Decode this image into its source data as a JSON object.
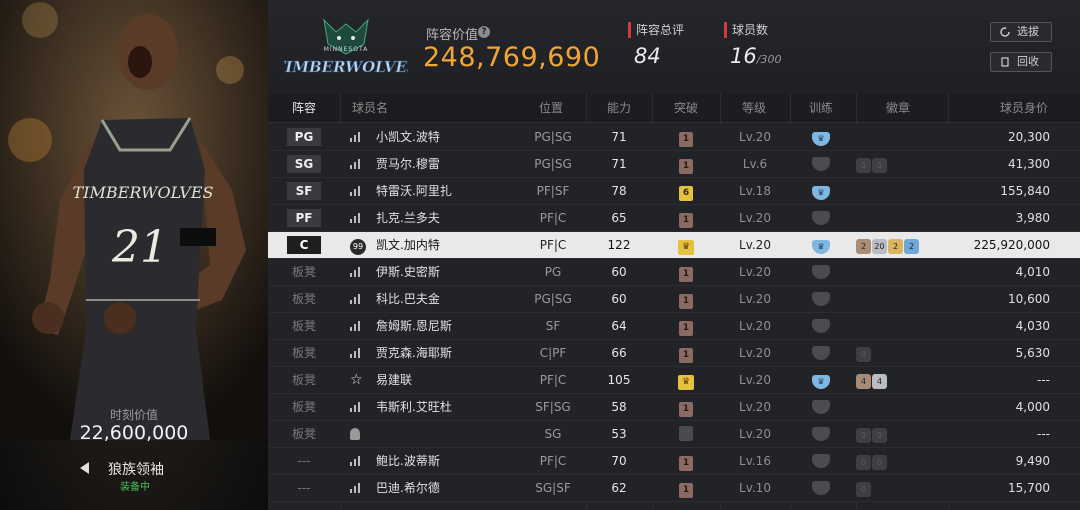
{
  "player_card": {
    "value_label": "时刻价值",
    "value": "22,600,000",
    "equip_name": "狼族领袖",
    "equip_status": "装备中",
    "jersey_team": "TIMBERWOLVES",
    "jersey_number": "21"
  },
  "header": {
    "logo_top": "MINNESOTA",
    "logo_main": "TIMBERWOLVES",
    "lineup_value_label": "阵容价值",
    "help_icon": "?",
    "lineup_value": "248,769,690",
    "rating_label": "阵容总评",
    "rating_value": "84",
    "count_label": "球员数",
    "count_value": "16",
    "count_total": "/300",
    "select_button": "选拔",
    "back_button": "回收"
  },
  "columns": {
    "slot": "阵容",
    "name": "球员名",
    "position": "位置",
    "ovr": "能力",
    "breakthrough": "突破",
    "level": "等级",
    "training": "训练",
    "badges": "徽章",
    "salary": "球员身价"
  },
  "rows": [
    {
      "slot": "PG",
      "bench": false,
      "icon": "bars",
      "name": "小凯文.波特",
      "position": "PG|SG",
      "ovr": "71",
      "brk": "1",
      "brk_style": "",
      "level": "Lv.20",
      "train": true,
      "badges": [],
      "salary": "20,300"
    },
    {
      "slot": "SG",
      "bench": false,
      "icon": "bars",
      "name": "贾马尔.穆雷",
      "position": "PG|SG",
      "ovr": "71",
      "brk": "1",
      "brk_style": "",
      "level": "Lv.6",
      "train": false,
      "badges": [
        {
          "t": "0",
          "c": "dim"
        },
        {
          "t": "0",
          "c": "dim"
        }
      ],
      "salary": "41,300"
    },
    {
      "slot": "SF",
      "bench": false,
      "icon": "bars",
      "name": "特雷沃.阿里扎",
      "position": "PF|SF",
      "ovr": "78",
      "brk": "6",
      "brk_style": "gold",
      "level": "Lv.18",
      "train": true,
      "badges": [],
      "salary": "155,840"
    },
    {
      "slot": "PF",
      "bench": false,
      "icon": "bars",
      "name": "扎克.兰多夫",
      "position": "PF|C",
      "ovr": "65",
      "brk": "1",
      "brk_style": "",
      "level": "Lv.20",
      "train": false,
      "badges": [],
      "salary": "3,980"
    },
    {
      "slot": "C",
      "bench": false,
      "selected": true,
      "icon": "99",
      "name": "凯文.加内特",
      "position": "PF|C",
      "ovr": "122",
      "brk": "♛",
      "brk_style": "crown",
      "level": "Lv.20",
      "train": true,
      "badges": [
        {
          "t": "2",
          "c": "bronze"
        },
        {
          "t": "20",
          "c": "silver"
        },
        {
          "t": "2",
          "c": "gold"
        },
        {
          "t": "2",
          "c": "blue"
        }
      ],
      "salary": "225,920,000"
    },
    {
      "slot": "板凳",
      "bench": true,
      "icon": "bars",
      "name": "伊斯.史密斯",
      "position": "PG",
      "ovr": "60",
      "brk": "1",
      "brk_style": "",
      "level": "Lv.20",
      "train": false,
      "badges": [],
      "salary": "4,010"
    },
    {
      "slot": "板凳",
      "bench": true,
      "icon": "bars",
      "name": "科比.巴夫金",
      "position": "PG|SG",
      "ovr": "60",
      "brk": "1",
      "brk_style": "",
      "level": "Lv.20",
      "train": false,
      "badges": [],
      "salary": "10,600"
    },
    {
      "slot": "板凳",
      "bench": true,
      "icon": "bars",
      "name": "詹姆斯.恩尼斯",
      "position": "SF",
      "ovr": "64",
      "brk": "1",
      "brk_style": "",
      "level": "Lv.20",
      "train": false,
      "badges": [],
      "salary": "4,030"
    },
    {
      "slot": "板凳",
      "bench": true,
      "icon": "bars",
      "name": "贾克森.海耶斯",
      "position": "C|PF",
      "ovr": "66",
      "brk": "1",
      "brk_style": "",
      "level": "Lv.20",
      "train": false,
      "badges": [
        {
          "t": "0",
          "c": "dim"
        }
      ],
      "salary": "5,630"
    },
    {
      "slot": "板凳",
      "bench": true,
      "icon": "star",
      "name": "易建联",
      "position": "PF|C",
      "ovr": "105",
      "brk": "♛",
      "brk_style": "crown",
      "level": "Lv.20",
      "train": true,
      "badges": [
        {
          "t": "4",
          "c": "bronze"
        },
        {
          "t": "4",
          "c": "silver"
        }
      ],
      "salary": "---"
    },
    {
      "slot": "板凳",
      "bench": true,
      "icon": "bars",
      "name": "韦斯利.艾旺杜",
      "position": "SF|SG",
      "ovr": "58",
      "brk": "1",
      "brk_style": "",
      "level": "Lv.20",
      "train": false,
      "badges": [],
      "salary": "4,000"
    },
    {
      "slot": "板凳",
      "bench": true,
      "icon": "blur",
      "name": "",
      "position": "SG",
      "ovr": "53",
      "brk": "",
      "brk_style": "dim",
      "level": "Lv.20",
      "train": false,
      "badges": [
        {
          "t": "0",
          "c": "dim"
        },
        {
          "t": "0",
          "c": "dim"
        }
      ],
      "salary": "---"
    },
    {
      "slot": "---",
      "bench": true,
      "icon": "bars",
      "name": "鲍比.波蒂斯",
      "position": "PF|C",
      "ovr": "70",
      "brk": "1",
      "brk_style": "",
      "level": "Lv.16",
      "train": false,
      "badges": [
        {
          "t": "0",
          "c": "dim"
        },
        {
          "t": "0",
          "c": "dim"
        }
      ],
      "salary": "9,490"
    },
    {
      "slot": "---",
      "bench": true,
      "icon": "bars",
      "name": "巴迪.希尔德",
      "position": "SG|SF",
      "ovr": "62",
      "brk": "1",
      "brk_style": "",
      "level": "Lv.10",
      "train": false,
      "badges": [
        {
          "t": "0",
          "c": "dim"
        }
      ],
      "salary": "15,700"
    }
  ],
  "colors": {
    "accent_orange": "#f0a535",
    "stat_red": "#d23a3a",
    "equip_green": "#46c25a",
    "train_blue": "#7eb8e2"
  }
}
